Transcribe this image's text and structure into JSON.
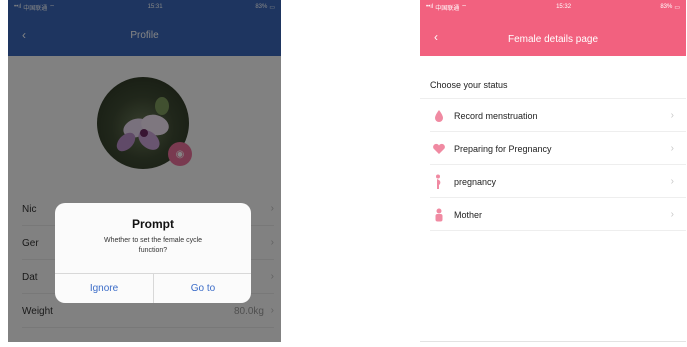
{
  "left": {
    "status": {
      "carrier": "中国联通",
      "time": "15:31",
      "battery": "83%"
    },
    "nav_title": "Profile",
    "back_glyph": "‹",
    "rows": [
      {
        "label": "Nic",
        "value": "",
        "arrow": "›"
      },
      {
        "label": "Ger",
        "value": "",
        "arrow": "›"
      },
      {
        "label": "Dat",
        "value": "",
        "arrow": "›"
      },
      {
        "label": "Weight",
        "value": "80.0kg",
        "arrow": "›"
      }
    ],
    "dialog": {
      "title": "Prompt",
      "message": "Whether to set the female cycle function?",
      "ignore_label": "Ignore",
      "goto_label": "Go to"
    },
    "colors": {
      "nav": "#3a67b9",
      "link": "#3b6cc8",
      "camera": "#e96f99"
    }
  },
  "right": {
    "status": {
      "carrier": "中国联通",
      "time": "15:32",
      "battery": "83%"
    },
    "nav_title": "Female details page",
    "back_glyph": "‹",
    "section_title": "Choose your status",
    "items": [
      {
        "label": "Record menstruation",
        "icon": "droplet-icon",
        "arrow": "›"
      },
      {
        "label": "Preparing for Pregnancy",
        "icon": "heart-icon",
        "arrow": "›"
      },
      {
        "label": "pregnancy",
        "icon": "pregnant-icon",
        "arrow": "›"
      },
      {
        "label": "Mother",
        "icon": "mother-icon",
        "arrow": "›"
      }
    ],
    "colors": {
      "nav": "#f2617f",
      "icon": "#f08aa2"
    }
  }
}
